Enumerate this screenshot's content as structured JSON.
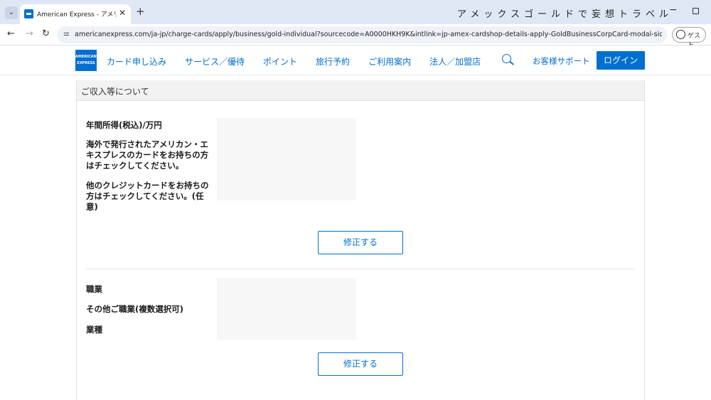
{
  "browser": {
    "tab_title": "American Express - アメリカン・エ",
    "window_title": "アメックスゴールドで妄想トラベル",
    "url": "americanexpress.com/ja-jp/charge-cards/apply/business/gold-individual?sourcecode=A0000HKH9K&intlink=jp-amex-cardshop-details-apply-GoldBusinessCorpCard-modal-side-rail&cpid=1005811...",
    "profile_label": "ゲスト"
  },
  "header": {
    "logo_text": "AMERICAN EXPRESS",
    "nav": [
      "カード申し込み",
      "サービス／優待",
      "ポイント",
      "旅行予約",
      "ご利用案内",
      "法人／加盟店"
    ],
    "support": "お客様サポート",
    "login": "ログイン"
  },
  "section": {
    "title": "ご収入等について",
    "group1": {
      "annual_income": "年間所得(税込)/万円",
      "overseas_card": "海外で発行されたアメリカン・エキスプレスのカードをお持ちの方はチェックしてください。",
      "other_credit": "他のクレジットカードをお持ちの方はチェックしてください。(任意)",
      "edit": "修正する"
    },
    "group2": {
      "occupation": "職業",
      "other_occupation": "その他ご職業(複数選択可)",
      "industry": "業種",
      "edit": "修正する"
    }
  }
}
